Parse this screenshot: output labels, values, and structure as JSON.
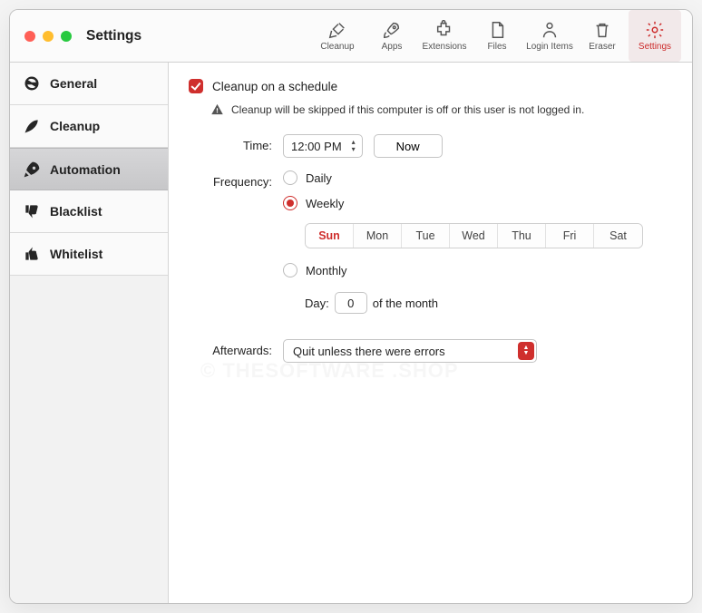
{
  "window": {
    "title": "Settings"
  },
  "toolbar": [
    {
      "label": "Cleanup"
    },
    {
      "label": "Apps"
    },
    {
      "label": "Extensions"
    },
    {
      "label": "Files"
    },
    {
      "label": "Login Items"
    },
    {
      "label": "Eraser"
    },
    {
      "label": "Settings"
    }
  ],
  "sidebar": [
    {
      "label": "General"
    },
    {
      "label": "Cleanup"
    },
    {
      "label": "Automation"
    },
    {
      "label": "Blacklist"
    },
    {
      "label": "Whitelist"
    }
  ],
  "form": {
    "schedule_checkbox_label": "Cleanup on a schedule",
    "schedule_checked": true,
    "warning_text": "Cleanup will be skipped if this computer is off or this user is not logged in.",
    "time_label": "Time:",
    "time_value": "12:00 PM",
    "now_button": "Now",
    "frequency_label": "Frequency:",
    "frequency_options": {
      "daily": "Daily",
      "weekly": "Weekly",
      "monthly": "Monthly"
    },
    "frequency_selected": "weekly",
    "days": [
      "Sun",
      "Mon",
      "Tue",
      "Wed",
      "Thu",
      "Fri",
      "Sat"
    ],
    "day_selected_index": 0,
    "monthly_day_label": "Day:",
    "monthly_day_value": "0",
    "monthly_suffix": "of the month",
    "afterwards_label": "Afterwards:",
    "afterwards_value": "Quit unless there were errors"
  },
  "watermark": "© THESOFTWARE .SHOP"
}
